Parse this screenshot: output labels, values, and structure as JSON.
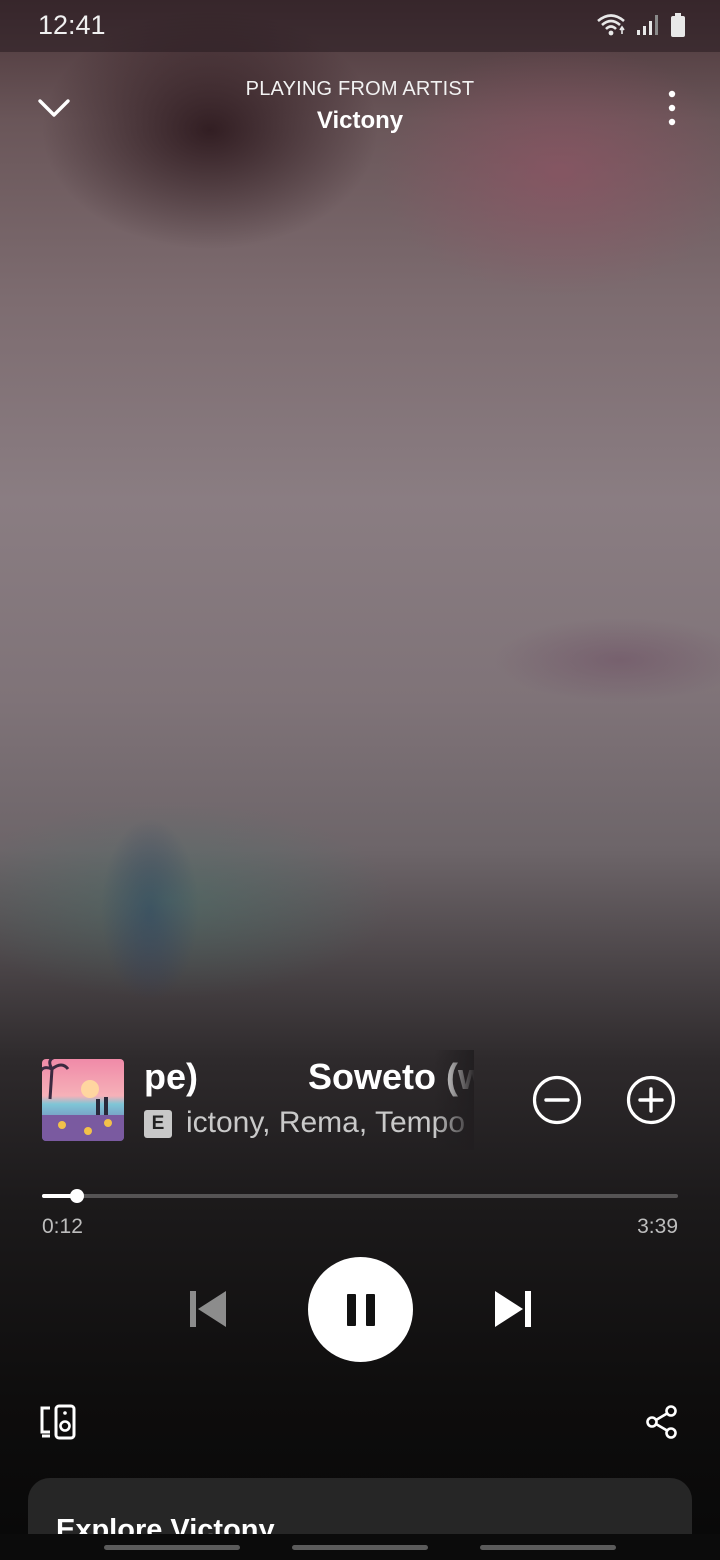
{
  "status_bar": {
    "time": "12:41"
  },
  "header": {
    "context_label": "PLAYING FROM ARTIST",
    "context_name": "Victony"
  },
  "track": {
    "title_scroll_tail": "pe)",
    "title_scroll_head": "Soweto (w",
    "explicit_badge": "E",
    "artists_visible": "ictony, Rema, Tempo"
  },
  "playback": {
    "elapsed": "0:12",
    "total": "3:39",
    "progress_fraction": 0.055
  },
  "explore": {
    "title": "Explore Victony"
  },
  "colors": {
    "accent_white": "#ffffff",
    "secondary_text": "#c9c9c9",
    "card_bg": "#262626"
  },
  "icons": {
    "collapse": "chevron-down-icon",
    "more": "more-vertical-icon",
    "remove": "minus-circle-icon",
    "add": "plus-circle-icon",
    "previous": "skip-previous-icon",
    "pause": "pause-icon",
    "next": "skip-next-icon",
    "devices": "connect-devices-icon",
    "share": "share-icon"
  }
}
